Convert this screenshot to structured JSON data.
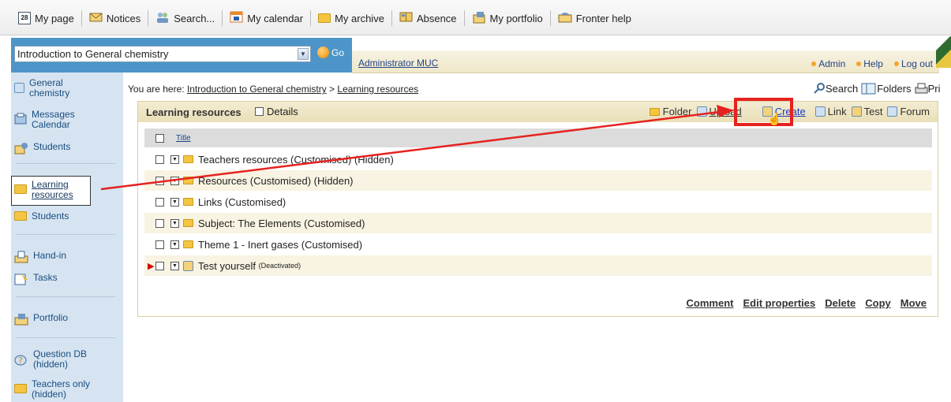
{
  "topnav": {
    "items": [
      {
        "label": "My page",
        "icon": "calendar-28-icon"
      },
      {
        "label": "Notices",
        "icon": "envelope-icon"
      },
      {
        "label": "Search...",
        "icon": "people-search-icon"
      },
      {
        "label": "My calendar",
        "icon": "calendar-icon"
      },
      {
        "label": "My archive",
        "icon": "folder-icon"
      },
      {
        "label": "Absence",
        "icon": "book-icon"
      },
      {
        "label": "My portfolio",
        "icon": "portfolio-icon"
      },
      {
        "label": "Fronter help",
        "icon": "help-icon"
      }
    ],
    "calendar_day": "28"
  },
  "course_select": {
    "value": "Introduction to General chemistry",
    "go_label": "Go"
  },
  "adminbar": {
    "user": "Administrator MUC",
    "links": [
      "Admin",
      "Help",
      "Log out"
    ]
  },
  "sidebar": {
    "items": [
      {
        "label": "General\nchemistry"
      },
      {
        "label": "Messages\nCalendar"
      },
      {
        "label": "Students"
      },
      {
        "label": "Learning\nresources"
      },
      {
        "label": "Students"
      },
      {
        "label": "Hand-in"
      },
      {
        "label": "Tasks"
      },
      {
        "label": "Portfolio"
      },
      {
        "label": "Question DB\n(hidden)"
      },
      {
        "label": "Teachers only\n(hidden)"
      }
    ]
  },
  "breadcrumb": {
    "prefix": "You are here: ",
    "course": "Introduction to General chemistry",
    "sep": " > ",
    "page": "Learning resources"
  },
  "top_tools": {
    "search": "Search",
    "folders": "Folders",
    "print": "Pri"
  },
  "panel": {
    "title": "Learning resources",
    "details_label": "Details",
    "actions": [
      "Folder",
      "Upload",
      "Create",
      "Link",
      "Test",
      "Forum"
    ],
    "column_title": "Title",
    "rows": [
      {
        "name": "Teachers resources (Customised) (Hidden)",
        "suffix": ""
      },
      {
        "name": "Resources (Customised) (Hidden)",
        "suffix": ""
      },
      {
        "name": "Links (Customised)",
        "suffix": ""
      },
      {
        "name": "Subject: The Elements (Customised)",
        "suffix": ""
      },
      {
        "name": "Theme 1 - Inert gases (Customised)",
        "suffix": ""
      },
      {
        "name": "Test yourself",
        "suffix": "(Deactivated)"
      }
    ],
    "bottom_actions": [
      "Comment",
      "Edit properties",
      "Delete",
      "Copy",
      "Move"
    ]
  },
  "colors": {
    "accent": "#4d95c8",
    "highlight": "#e5221f",
    "sidebar": "#d6e4f1"
  }
}
